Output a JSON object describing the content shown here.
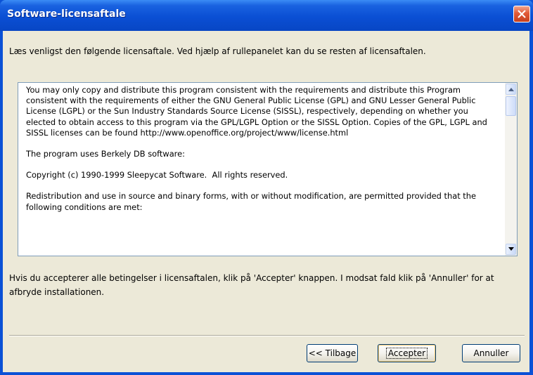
{
  "window": {
    "title": "Software-licensaftale",
    "close_icon": "close-icon"
  },
  "instruction": "Læs venligst den følgende licensaftale. Ved hjælp af rullepanelet kan du se resten af licensaftalen.",
  "license": {
    "paragraphs": [
      "You may only copy and distribute this program consistent with the requirements and distribute this Program consistent with the requirements of either the GNU General Public License (GPL) and GNU Lesser General Public License (LGPL) or the Sun Industry Standards Source License (SISSL), respectively, depending on whether you elected to obtain access to this program via the GPL/LGPL Option or the SISSL Option. Copies of the GPL, LGPL and SISSL licenses can be found http://www.openoffice.org/project/www/license.html",
      "The program uses Berkely DB software:",
      "Copyright (c) 1990-1999 Sleepycat Software.  All rights reserved.",
      "Redistribution and use in source and binary forms, with or without modification, are permitted provided that the following conditions are met:"
    ]
  },
  "footer_text": "Hvis du accepterer alle betingelser i licensaftalen, klik på 'Accepter' knappen. I modsat fald klik på 'Annuller' for at afbryde installationen.",
  "buttons": {
    "back": "<< Tilbage",
    "accept": "Accepter",
    "cancel": "Annuller"
  },
  "colors": {
    "titlebar": "#0a4fd4",
    "dialog_bg": "#ece9d8",
    "close_button": "#e25a36"
  }
}
